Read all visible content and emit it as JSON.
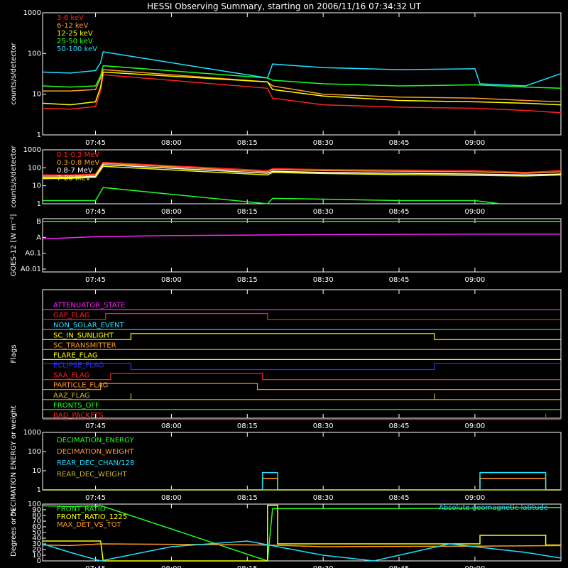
{
  "title": "HESSI Observing Summary, starting on 2006/11/16 07:34:32 UT",
  "colors": {
    "red": "#ff2020",
    "orange": "#ff9a28",
    "yellow": "#ffff00",
    "green": "#20ff20",
    "cyan": "#20e0ff",
    "magenta": "#ff20ff",
    "blue": "#3030ff",
    "olive": "#c8b830",
    "white": "#ffffff"
  },
  "time_axis": {
    "start": "07:34:32",
    "end": "09:17",
    "tick_labels": [
      "07:45",
      "08:00",
      "08:15",
      "08:30",
      "08:45",
      "09:00"
    ]
  },
  "chart_data": [
    {
      "id": "hessi-rates-low",
      "type": "line",
      "ylabel": "counts/s/detector",
      "yscale": "log",
      "ylim": [
        1,
        1000
      ],
      "ytick_labels": [
        "1",
        "10",
        "100",
        "1000"
      ],
      "legend_position": "top-left",
      "gaps": [
        [
          "07:47",
          "08:19"
        ]
      ],
      "series": [
        {
          "name": "3-6 keV",
          "color": "red",
          "x": [
            "07:34:32",
            "07:40",
            "07:45",
            "07:46",
            "07:46:30",
            "08:19",
            "08:20",
            "08:30",
            "08:45",
            "09:00",
            "09:10",
            "09:17"
          ],
          "y": [
            4.5,
            4.3,
            5,
            12,
            30,
            14,
            8,
            5.5,
            4.8,
            4.5,
            4,
            3.5
          ]
        },
        {
          "name": "6-12 keV",
          "color": "orange",
          "x": [
            "07:34:32",
            "07:40",
            "07:45",
            "07:46",
            "07:46:30",
            "08:19",
            "08:20",
            "08:30",
            "08:45",
            "09:00",
            "09:10",
            "09:17"
          ],
          "y": [
            12,
            12,
            13,
            25,
            40,
            20,
            16,
            10,
            8.5,
            8,
            7,
            6.5
          ]
        },
        {
          "name": "12-25 keV",
          "color": "yellow",
          "x": [
            "07:34:32",
            "07:40",
            "07:45",
            "07:46",
            "07:46:30",
            "08:19",
            "08:20",
            "08:30",
            "08:45",
            "09:00",
            "09:10",
            "09:17"
          ],
          "y": [
            6,
            5.5,
            6.5,
            15,
            35,
            20,
            13,
            9,
            7,
            6.5,
            6,
            5.5
          ]
        },
        {
          "name": "25-50 keV",
          "color": "green",
          "x": [
            "07:34:32",
            "07:40",
            "07:45",
            "07:46",
            "07:46:30",
            "08:19",
            "08:20",
            "08:30",
            "08:45",
            "09:00",
            "09:10",
            "09:17"
          ],
          "y": [
            16,
            15,
            16,
            28,
            50,
            25,
            22,
            18,
            16,
            17,
            15,
            14
          ]
        },
        {
          "name": "50-100 keV",
          "color": "cyan",
          "x": [
            "07:34:32",
            "07:40",
            "07:45",
            "07:46",
            "07:46:30",
            "08:19",
            "08:20",
            "08:30",
            "08:45",
            "09:00",
            "09:01",
            "09:10",
            "09:17"
          ],
          "y": [
            35,
            33,
            38,
            60,
            110,
            25,
            55,
            45,
            40,
            42,
            18,
            16,
            32
          ]
        }
      ]
    },
    {
      "id": "hessi-rates-high",
      "type": "line",
      "ylabel": "counts/s/detector",
      "yscale": "log",
      "ylim": [
        1,
        1000
      ],
      "ytick_labels": [
        "1",
        "10",
        "100",
        "1000"
      ],
      "legend_position": "top-left",
      "gaps": [
        [
          "07:47",
          "08:19"
        ]
      ],
      "series": [
        {
          "name": "0.1-0.3 MeV",
          "color": "red",
          "x": [
            "07:34:32",
            "07:40",
            "07:45",
            "07:46:30",
            "08:19",
            "08:20",
            "08:30",
            "08:45",
            "09:00",
            "09:10",
            "09:17"
          ],
          "y": [
            40,
            40,
            45,
            200,
            70,
            90,
            80,
            75,
            70,
            55,
            70
          ]
        },
        {
          "name": "0.3-0.8 MeV",
          "color": "orange",
          "x": [
            "07:34:32",
            "07:40",
            "07:45",
            "07:46:30",
            "08:19",
            "08:20",
            "08:30",
            "08:45",
            "09:00",
            "09:10",
            "09:17"
          ],
          "y": [
            35,
            35,
            40,
            180,
            60,
            80,
            70,
            65,
            60,
            50,
            60
          ]
        },
        {
          "name": "0.8-7 MeV",
          "color": "white",
          "x": [
            "07:34:32",
            "07:40",
            "07:45",
            "07:46:30",
            "08:19",
            "08:20",
            "08:30",
            "08:45",
            "09:00",
            "09:10",
            "09:17"
          ],
          "y": [
            30,
            30,
            34,
            150,
            50,
            65,
            55,
            50,
            45,
            40,
            45
          ]
        },
        {
          "name": "7-20 MeV",
          "color": "yellow",
          "x": [
            "07:34:32",
            "07:40",
            "07:45",
            "07:46:30",
            "08:19",
            "08:20",
            "08:30",
            "08:45",
            "09:00",
            "09:10",
            "09:17"
          ],
          "y": [
            25,
            26,
            30,
            120,
            40,
            55,
            48,
            42,
            38,
            35,
            40
          ]
        },
        {
          "name": "",
          "color": "green",
          "x": [
            "07:34:32",
            "07:40",
            "07:45",
            "07:46:30",
            "08:19",
            "08:20",
            "08:30",
            "08:45",
            "09:00",
            "09:05"
          ],
          "y": [
            1.5,
            1.5,
            1.5,
            8,
            1,
            2,
            1.8,
            1.5,
            1.5,
            1
          ]
        }
      ]
    },
    {
      "id": "goes",
      "type": "line",
      "ylabel": "GOES-12 [W m⁻²]",
      "ytick_labels": [
        "A0.01",
        "A0.1",
        "A",
        "B"
      ],
      "series": [
        {
          "name": "",
          "color": "green",
          "x": [
            "07:34:32",
            "09:17"
          ],
          "y": [
            "B",
            "B"
          ]
        },
        {
          "name": "",
          "color": "magenta",
          "x": [
            "07:34:32",
            "07:45",
            "08:00",
            "08:30",
            "09:00",
            "09:17"
          ],
          "y": [
            0.08,
            0.11,
            0.13,
            0.15,
            0.16,
            0.16
          ]
        }
      ]
    },
    {
      "id": "flags",
      "type": "line",
      "ylabel": "Flags",
      "series": [
        {
          "name": "ATTENUATOR_STATE",
          "color": "magenta",
          "x": [
            "07:34:32",
            "09:17"
          ],
          "y": [
            0,
            0
          ]
        },
        {
          "name": "GAP_FLAG",
          "color": "red",
          "x": [
            "07:34:32",
            "07:47",
            "07:47",
            "08:19",
            "08:19",
            "09:17"
          ],
          "y": [
            0,
            0,
            1,
            1,
            0,
            0
          ]
        },
        {
          "name": "NON_SOLAR_EVENT",
          "color": "cyan",
          "x": [
            "07:34:32",
            "09:17"
          ],
          "y": [
            0,
            0
          ]
        },
        {
          "name": "SC_IN_SUNLIGHT",
          "color": "yellow",
          "x": [
            "07:34:32",
            "07:52",
            "07:52",
            "08:52",
            "08:52",
            "09:17"
          ],
          "y": [
            0,
            0,
            1,
            1,
            0,
            0
          ]
        },
        {
          "name": "SC_TRANSMITTER",
          "color": "orange",
          "x": [
            "07:34:32",
            "09:17"
          ],
          "y": [
            0,
            0
          ]
        },
        {
          "name": "FLARE_FLAG",
          "color": "yellow",
          "x": [
            "07:34:32",
            "09:17"
          ],
          "y": [
            0,
            0
          ]
        },
        {
          "name": "ECLIPSE_FLAG",
          "color": "blue",
          "x": [
            "07:34:32",
            "07:52",
            "07:52",
            "08:52",
            "08:52",
            "09:17"
          ],
          "y": [
            1,
            1,
            0,
            0,
            1,
            1
          ]
        },
        {
          "name": "SAA_FLAG",
          "color": "red",
          "x": [
            "07:34:32",
            "07:48",
            "07:48",
            "08:18",
            "08:18",
            "09:17"
          ],
          "y": [
            0,
            0,
            1,
            1,
            0,
            0
          ]
        },
        {
          "name": "PARTICLE_FLAG",
          "color": "orange",
          "x": [
            "07:34:32",
            "07:46",
            "07:46",
            "08:17",
            "08:17",
            "09:17"
          ],
          "y": [
            0,
            0,
            1,
            1,
            0,
            0
          ]
        },
        {
          "name": "AAZ_FLAG",
          "color": "olive",
          "x": [
            "07:34:32",
            "07:52",
            "07:52",
            "07:52",
            "08:52",
            "08:52",
            "08:52",
            "09:17"
          ],
          "y": [
            0,
            0,
            1,
            0,
            0,
            1,
            0,
            0
          ]
        },
        {
          "name": "FRONTS_OFF",
          "color": "green",
          "x": [
            "07:34:32",
            "09:17"
          ],
          "y": [
            0,
            0
          ]
        },
        {
          "name": "BAD_PACKETS",
          "color": "red",
          "x": [
            "07:34:32",
            "09:14",
            "09:14",
            "09:14",
            "09:17"
          ],
          "y": [
            0,
            0,
            1,
            0,
            0
          ]
        }
      ]
    },
    {
      "id": "decimation",
      "type": "line",
      "ylabel": "DECIMATION ENERGY or weight",
      "yscale": "log",
      "ylim": [
        1,
        1000
      ],
      "ytick_labels": [
        "1",
        "10",
        "100",
        "1000"
      ],
      "series": [
        {
          "name": "DECIMATION_ENERGY",
          "color": "green",
          "x": [
            "07:34:32",
            "09:17"
          ],
          "y": [
            1,
            1
          ]
        },
        {
          "name": "DECIMATION_WEIGHT",
          "color": "orange",
          "x": [
            "07:34:32",
            "08:18",
            "08:18",
            "08:21",
            "08:21",
            "09:01",
            "09:01",
            "09:14",
            "09:14",
            "09:17"
          ],
          "y": [
            1,
            1,
            4,
            4,
            1,
            1,
            4,
            4,
            1,
            1
          ]
        },
        {
          "name": "REAR_DEC_CHAN/128",
          "color": "cyan",
          "x": [
            "07:34:32",
            "08:18",
            "08:18",
            "08:21",
            "08:21",
            "09:01",
            "09:01",
            "09:14",
            "09:14",
            "09:17"
          ],
          "y": [
            1,
            1,
            8,
            8,
            1,
            1,
            8,
            8,
            1,
            1
          ]
        },
        {
          "name": "REAR_DEC_WEIGHT",
          "color": "olive",
          "x": [
            "07:34:32",
            "09:17"
          ],
          "y": [
            1,
            1
          ]
        }
      ]
    },
    {
      "id": "ratios",
      "type": "line",
      "ylabel": "Degrees or %",
      "ylim": [
        0,
        100
      ],
      "ytick_labels": [
        "0",
        "10",
        "20",
        "30",
        "40",
        "50",
        "60",
        "70",
        "80",
        "90",
        "100"
      ],
      "gaps": [
        [
          "07:47",
          "08:19"
        ]
      ],
      "series": [
        {
          "name": "FRONT_RATIO",
          "color": "green",
          "x": [
            "07:34:32",
            "07:40",
            "07:46",
            "07:46:30",
            "08:19",
            "08:20",
            "08:45",
            "09:17"
          ],
          "y": [
            97,
            96,
            97,
            96,
            0,
            92,
            92,
            94
          ]
        },
        {
          "name": "FRONT_RATIO_1225",
          "color": "yellow",
          "x": [
            "07:34:32",
            "07:46",
            "07:46:30",
            "08:19",
            "08:19",
            "08:21",
            "08:21",
            "09:01",
            "09:01",
            "09:14",
            "09:14",
            "09:17"
          ],
          "y": [
            35,
            35,
            0,
            0,
            98,
            98,
            30,
            30,
            45,
            45,
            28,
            28
          ]
        },
        {
          "name": "MAX_DET_VS_TOT",
          "color": "orange",
          "x": [
            "07:34:32",
            "07:40",
            "07:46",
            "08:19",
            "08:30",
            "09:00",
            "09:17"
          ],
          "y": [
            28,
            27,
            30,
            28,
            25,
            26,
            27
          ]
        },
        {
          "name": "Absolute geomagnetic latitude",
          "color": "cyan",
          "x": [
            "07:34:32",
            "07:40",
            "07:46",
            "08:00",
            "08:15",
            "08:30",
            "08:40",
            "08:55",
            "09:10",
            "09:17"
          ],
          "y": [
            30,
            15,
            0,
            25,
            35,
            10,
            0,
            30,
            15,
            5
          ]
        }
      ]
    }
  ]
}
